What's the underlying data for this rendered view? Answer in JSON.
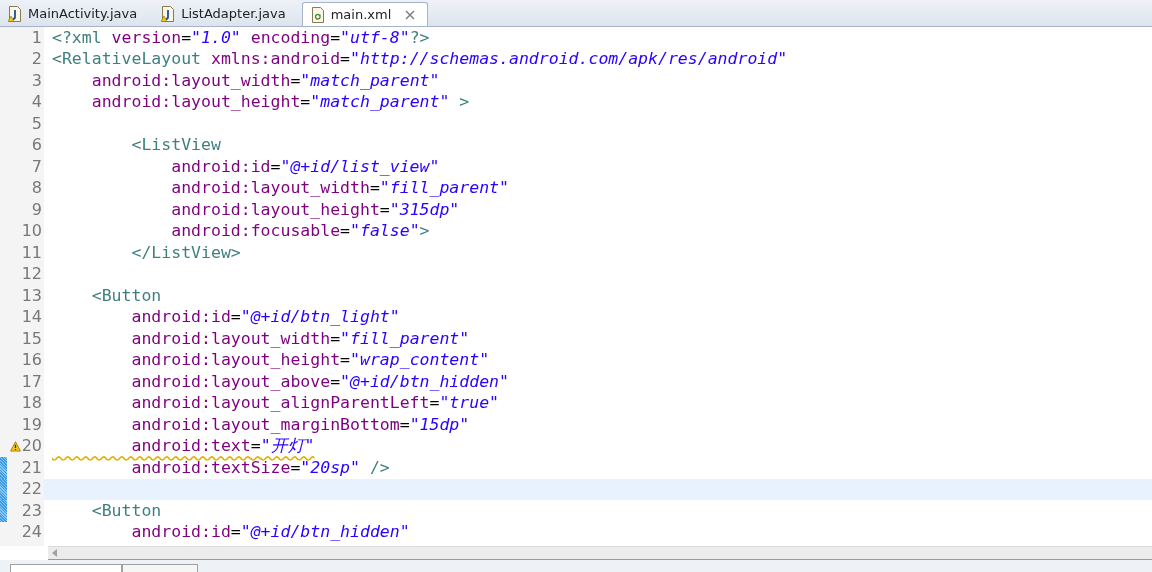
{
  "tabs": [
    {
      "label": "MainActivity.java",
      "kind": "java",
      "warning": true,
      "selected": false
    },
    {
      "label": "ListAdapter.java",
      "kind": "java",
      "warning": true,
      "selected": false
    },
    {
      "label": "main.xml",
      "kind": "xml",
      "warning": false,
      "selected": true
    }
  ],
  "editor": {
    "lines": [
      {
        "number": "1",
        "tokens": [
          {
            "kind": "tag",
            "t": "<?xml"
          },
          {
            "kind": "attr",
            "t": " version"
          },
          {
            "kind": "eq",
            "t": "="
          },
          {
            "kind": "value",
            "t": "\"1.0\""
          },
          {
            "kind": "attr",
            "t": " encoding"
          },
          {
            "kind": "eq",
            "t": "="
          },
          {
            "kind": "value",
            "t": "\"utf-8\""
          },
          {
            "kind": "tag",
            "t": "?>"
          }
        ]
      },
      {
        "number": "2",
        "tokens": [
          {
            "kind": "tag",
            "t": "<RelativeLayout"
          },
          {
            "kind": "attr",
            "t": " xmlns:android"
          },
          {
            "kind": "eq",
            "t": "="
          },
          {
            "kind": "value",
            "t": "\"http://schemas.android.com/apk/res/android\""
          }
        ]
      },
      {
        "number": "3",
        "tokens": [
          {
            "kind": "attr",
            "t": "    android:layout_width"
          },
          {
            "kind": "eq",
            "t": "="
          },
          {
            "kind": "value",
            "t": "\"match_parent\""
          }
        ]
      },
      {
        "number": "4",
        "tokens": [
          {
            "kind": "attr",
            "t": "    android:layout_height"
          },
          {
            "kind": "eq",
            "t": "="
          },
          {
            "kind": "value",
            "t": "\"match_parent\""
          },
          {
            "kind": "tag",
            "t": " >"
          }
        ]
      },
      {
        "number": "5"
      },
      {
        "number": "6",
        "tokens": [
          {
            "kind": "tag",
            "t": "        <ListView"
          }
        ]
      },
      {
        "number": "7",
        "tokens": [
          {
            "kind": "attr",
            "t": "            android:id"
          },
          {
            "kind": "eq",
            "t": "="
          },
          {
            "kind": "value",
            "t": "\"@+id/list_view\""
          }
        ]
      },
      {
        "number": "8",
        "tokens": [
          {
            "kind": "attr",
            "t": "            android:layout_width"
          },
          {
            "kind": "eq",
            "t": "="
          },
          {
            "kind": "value",
            "t": "\"fill_parent\""
          }
        ]
      },
      {
        "number": "9",
        "tokens": [
          {
            "kind": "attr",
            "t": "            android:layout_height"
          },
          {
            "kind": "eq",
            "t": "="
          },
          {
            "kind": "value",
            "t": "\"315dp\""
          }
        ]
      },
      {
        "number": "10",
        "tokens": [
          {
            "kind": "attr",
            "t": "            android:focusable"
          },
          {
            "kind": "eq",
            "t": "="
          },
          {
            "kind": "value",
            "t": "\"false\""
          },
          {
            "kind": "tag",
            "t": ">"
          }
        ]
      },
      {
        "number": "11",
        "tokens": [
          {
            "kind": "tag",
            "t": "        </ListView>"
          }
        ]
      },
      {
        "number": "12"
      },
      {
        "number": "13",
        "tokens": [
          {
            "kind": "tag",
            "t": "    <Button"
          }
        ]
      },
      {
        "number": "14",
        "tokens": [
          {
            "kind": "attr",
            "t": "        android:id"
          },
          {
            "kind": "eq",
            "t": "="
          },
          {
            "kind": "value",
            "t": "\"@+id/btn_light\""
          }
        ]
      },
      {
        "number": "15",
        "tokens": [
          {
            "kind": "attr",
            "t": "        android:layout_width"
          },
          {
            "kind": "eq",
            "t": "="
          },
          {
            "kind": "value",
            "t": "\"fill_parent\""
          }
        ]
      },
      {
        "number": "16",
        "tokens": [
          {
            "kind": "attr",
            "t": "        android:layout_height"
          },
          {
            "kind": "eq",
            "t": "="
          },
          {
            "kind": "value",
            "t": "\"wrap_content\""
          }
        ]
      },
      {
        "number": "17",
        "tokens": [
          {
            "kind": "attr",
            "t": "        android:layout_above"
          },
          {
            "kind": "eq",
            "t": "="
          },
          {
            "kind": "value",
            "t": "\"@+id/btn_hidden\""
          }
        ]
      },
      {
        "number": "18",
        "tokens": [
          {
            "kind": "attr",
            "t": "        android:layout_alignParentLeft"
          },
          {
            "kind": "eq",
            "t": "="
          },
          {
            "kind": "value",
            "t": "\"true\""
          }
        ]
      },
      {
        "number": "19",
        "tokens": [
          {
            "kind": "attr",
            "t": "        android:layout_marginBottom"
          },
          {
            "kind": "eq",
            "t": "="
          },
          {
            "kind": "value",
            "t": "\"15dp\""
          }
        ]
      },
      {
        "number": "20",
        "warning": true,
        "tokens": [
          {
            "kind": "attr",
            "t": "        android:text"
          },
          {
            "kind": "eq",
            "t": "="
          },
          {
            "kind": "value",
            "t": "\"开灯\""
          }
        ]
      },
      {
        "number": "21",
        "changed": true,
        "tokens": [
          {
            "kind": "attr",
            "t": "        android:textSize"
          },
          {
            "kind": "eq",
            "t": "="
          },
          {
            "kind": "value",
            "t": "\"20sp\""
          },
          {
            "kind": "tag",
            "t": " />"
          }
        ]
      },
      {
        "number": "22",
        "changed": true,
        "current": true
      },
      {
        "number": "23",
        "changed": true,
        "tokens": [
          {
            "kind": "tag",
            "t": "    <Button"
          }
        ]
      },
      {
        "number": "24",
        "tokens": [
          {
            "kind": "attr",
            "t": "        android:id"
          },
          {
            "kind": "eq",
            "t": "="
          },
          {
            "kind": "value",
            "t": "\"@+id/btn_hidden\""
          }
        ]
      }
    ]
  }
}
